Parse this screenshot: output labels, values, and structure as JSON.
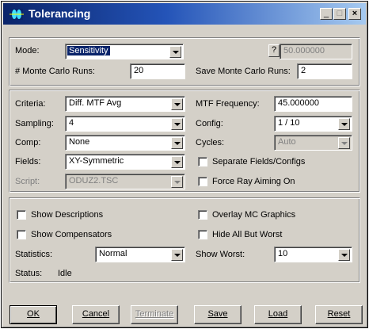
{
  "window": {
    "title": "Tolerancing",
    "minimize": "_",
    "maximize": "□",
    "close": "×"
  },
  "top": {
    "mode_label": "Mode:",
    "mode_value": "Sensitivity",
    "question_label": "?",
    "question_value": "50.000000",
    "mc_runs_label": "# Monte Carlo Runs:",
    "mc_runs_value": "20",
    "save_mc_label": "Save Monte Carlo Runs:",
    "save_mc_value": "2"
  },
  "criteria": {
    "criteria_label": "Criteria:",
    "criteria_value": "Diff. MTF Avg",
    "mtf_freq_label": "MTF Frequency:",
    "mtf_freq_value": "45.000000",
    "sampling_label": "Sampling:",
    "sampling_value": "4",
    "config_label": "Config:",
    "config_value": "1 / 10",
    "comp_label": "Comp:",
    "comp_value": "None",
    "cycles_label": "Cycles:",
    "cycles_value": "Auto",
    "fields_label": "Fields:",
    "fields_value": "XY-Symmetric",
    "separate_label": "Separate Fields/Configs",
    "script_label": "Script:",
    "script_value": "ODUZ2.TSC",
    "force_ray_label": "Force Ray Aiming On"
  },
  "display": {
    "show_desc_label": "Show Descriptions",
    "overlay_label": "Overlay MC Graphics",
    "show_comp_label": "Show Compensators",
    "hide_all_label": "Hide All But Worst",
    "statistics_label": "Statistics:",
    "statistics_value": "Normal",
    "show_worst_label": "Show Worst:",
    "show_worst_value": "10"
  },
  "status": {
    "label": "Status:",
    "value": "Idle"
  },
  "buttons": {
    "ok": "OK",
    "cancel": "Cancel",
    "terminate": "Terminate",
    "save": "Save",
    "load": "Load",
    "reset": "Reset"
  }
}
